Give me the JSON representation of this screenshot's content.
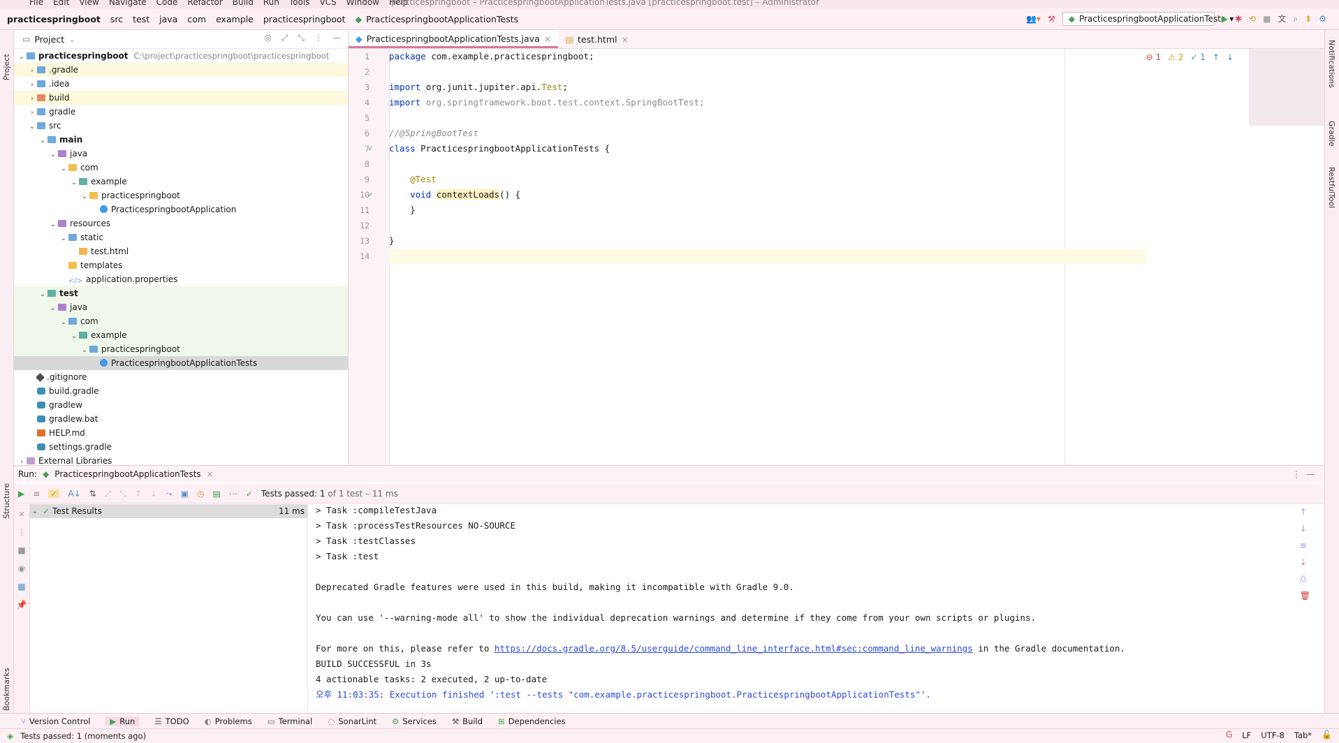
{
  "titlebar": {
    "menu": [
      "File",
      "Edit",
      "View",
      "Navigate",
      "Code",
      "Refactor",
      "Build",
      "Run",
      "Tools",
      "VCS",
      "Window",
      "Help"
    ],
    "window_title": "practicespringboot – PracticespringbootApplicationTests.java [practicespringboot.test] – Administrator"
  },
  "navbar": {
    "crumbs": [
      "practicespringboot",
      "src",
      "test",
      "java",
      "com",
      "example",
      "practicespringboot",
      "PracticespringbootApplicationTests"
    ],
    "run_config": "PracticespringbootApplicationTests"
  },
  "left_strip": {
    "project": "Project",
    "structure": "Structure",
    "bookmarks": "Bookmarks"
  },
  "right_strip": {
    "notifications": "Notifications",
    "gradle": "Gradle",
    "restful": "RestfulTool"
  },
  "project": {
    "title": "Project",
    "root": "practicespringboot",
    "root_path": "C:\\project\\practicespringboot\\practicespringboot",
    "items": [
      {
        "label": ".gradle",
        "depth": 1,
        "arrow": "›",
        "icon": "bfolder",
        "bg": "hl"
      },
      {
        "label": ".idea",
        "depth": 1,
        "arrow": "›",
        "icon": "bfolder",
        "bg": ""
      },
      {
        "label": "build",
        "depth": 1,
        "arrow": "›",
        "icon": "ofolder",
        "bg": "hl"
      },
      {
        "label": "gradle",
        "depth": 1,
        "arrow": "›",
        "icon": "bfolder",
        "bg": ""
      },
      {
        "label": "src",
        "depth": 1,
        "arrow": "⌄",
        "icon": "bfolder",
        "bg": ""
      },
      {
        "label": "main",
        "depth": 2,
        "arrow": "⌄",
        "icon": "bfolder",
        "bg": "",
        "bold": true
      },
      {
        "label": "java",
        "depth": 3,
        "arrow": "⌄",
        "icon": "pfolder",
        "bg": ""
      },
      {
        "label": "com",
        "depth": 4,
        "arrow": "⌄",
        "icon": "folder",
        "bg": ""
      },
      {
        "label": "example",
        "depth": 5,
        "arrow": "⌄",
        "icon": "tfolder",
        "bg": ""
      },
      {
        "label": "practicespringboot",
        "depth": 6,
        "arrow": "⌄",
        "icon": "folder",
        "bg": ""
      },
      {
        "label": "PracticespringbootApplication",
        "depth": 7,
        "arrow": "",
        "icon": "java",
        "bg": ""
      },
      {
        "label": "resources",
        "depth": 3,
        "arrow": "⌄",
        "icon": "pfolder",
        "bg": ""
      },
      {
        "label": "static",
        "depth": 4,
        "arrow": "⌄",
        "icon": "bfolder",
        "bg": ""
      },
      {
        "label": "test.html",
        "depth": 5,
        "arrow": "",
        "icon": "html",
        "bg": ""
      },
      {
        "label": "templates",
        "depth": 4,
        "arrow": "",
        "icon": "folder",
        "bg": ""
      },
      {
        "label": "application.properties",
        "depth": 4,
        "arrow": "",
        "icon": "prop",
        "bg": ""
      },
      {
        "label": "test",
        "depth": 2,
        "arrow": "⌄",
        "icon": "tfolder",
        "bg": "tg",
        "bold": true
      },
      {
        "label": "java",
        "depth": 3,
        "arrow": "⌄",
        "icon": "pfolder",
        "bg": "tg"
      },
      {
        "label": "com",
        "depth": 4,
        "arrow": "⌄",
        "icon": "bfolder",
        "bg": "tg"
      },
      {
        "label": "example",
        "depth": 5,
        "arrow": "⌄",
        "icon": "tfolder",
        "bg": "tg"
      },
      {
        "label": "practicespringboot",
        "depth": 6,
        "arrow": "⌄",
        "icon": "bfolder",
        "bg": "tg"
      },
      {
        "label": "PracticespringbootApplicationTests",
        "depth": 7,
        "arrow": "",
        "icon": "java",
        "bg": "sel"
      },
      {
        "label": ".gitignore",
        "depth": 1,
        "arrow": "",
        "icon": "git",
        "bg": ""
      },
      {
        "label": "build.gradle",
        "depth": 1,
        "arrow": "",
        "icon": "gradle",
        "bg": ""
      },
      {
        "label": "gradlew",
        "depth": 1,
        "arrow": "",
        "icon": "gradle",
        "bg": ""
      },
      {
        "label": "gradlew.bat",
        "depth": 1,
        "arrow": "",
        "icon": "gradle",
        "bg": ""
      },
      {
        "label": "HELP.md",
        "depth": 1,
        "arrow": "",
        "icon": "md",
        "bg": ""
      },
      {
        "label": "settings.gradle",
        "depth": 1,
        "arrow": "",
        "icon": "gradle",
        "bg": ""
      },
      {
        "label": "External Libraries",
        "depth": 0,
        "arrow": "›",
        "icon": "ext",
        "bg": ""
      }
    ]
  },
  "editor": {
    "tabs": [
      {
        "label": "PracticespringbootApplicationTests.java",
        "active": true
      },
      {
        "label": "test.html",
        "active": false
      }
    ],
    "indicators": {
      "errors": "1",
      "warnings": "2",
      "weak": "1"
    },
    "lines": [
      [
        {
          "t": "package ",
          "c": "kw"
        },
        {
          "t": "com.example.practicespringboot;",
          "c": ""
        }
      ],
      [],
      [
        {
          "t": "import ",
          "c": "kw"
        },
        {
          "t": "org.junit.jupiter.api.",
          "c": ""
        },
        {
          "t": "Test",
          "c": "ann"
        },
        {
          "t": ";",
          "c": ""
        }
      ],
      [
        {
          "t": "import ",
          "c": "kw"
        },
        {
          "t": "org.springframework.boot.test.context.SpringBootTest;",
          "c": "dim"
        }
      ],
      [],
      [
        {
          "t": "//@SpringBootTest",
          "c": "cm"
        }
      ],
      [
        {
          "t": "class ",
          "c": "kw"
        },
        {
          "t": "PracticespringbootApplicationTests {",
          "c": ""
        }
      ],
      [],
      [
        {
          "t": "    @Test",
          "c": "ann"
        }
      ],
      [
        {
          "t": "    ",
          "c": ""
        },
        {
          "t": "void ",
          "c": "kw"
        },
        {
          "t": "contextLoads",
          "c": "fn"
        },
        {
          "t": "() {",
          "c": ""
        }
      ],
      [
        {
          "t": "    }",
          "c": ""
        }
      ],
      [],
      [
        {
          "t": "}",
          "c": ""
        }
      ],
      []
    ]
  },
  "run": {
    "label": "Run:",
    "tab": "PracticespringbootApplicationTests",
    "status_prefix": "Tests passed: ",
    "status_count": "1",
    "status_suffix": " of 1 test – 11 ms",
    "results_label": "Test Results",
    "results_time": "11 ms",
    "console": [
      {
        "t": "> Task :compileTestJava",
        "c": ""
      },
      {
        "t": "> Task :processTestResources NO-SOURCE",
        "c": ""
      },
      {
        "t": "> Task :testClasses",
        "c": ""
      },
      {
        "t": "> Task :test",
        "c": ""
      },
      {
        "t": "",
        "c": ""
      },
      {
        "t": "Deprecated Gradle features were used in this build, making it incompatible with Gradle 9.0.",
        "c": ""
      },
      {
        "t": "",
        "c": ""
      },
      {
        "t": "You can use '--warning-mode all' to show the individual deprecation warnings and determine if they come from your own scripts or plugins.",
        "c": ""
      },
      {
        "t": "",
        "c": ""
      },
      {
        "t": "For more on this, please refer to ",
        "c": "",
        "link": "https://docs.gradle.org/8.5/userguide/command_line_interface.html#sec:command_line_warnings",
        "after": " in the Gradle documentation."
      },
      {
        "t": "BUILD SUCCESSFUL in 3s",
        "c": ""
      },
      {
        "t": "4 actionable tasks: 2 executed, 2 up-to-date",
        "c": ""
      },
      {
        "t": "오후 11:03:35: Execution finished ':test --tests \"com.example.practicespringboot.PracticespringbootApplicationTests\"'.",
        "c": "blue"
      }
    ]
  },
  "toolwindows": [
    "Version Control",
    "Run",
    "TODO",
    "Problems",
    "Terminal",
    "SonarLint",
    "Services",
    "Build",
    "Dependencies"
  ],
  "statusbar": {
    "message": "Tests passed: 1 (moments ago)",
    "line_sep": "LF",
    "encoding": "UTF-8",
    "indent": "Tab*"
  }
}
